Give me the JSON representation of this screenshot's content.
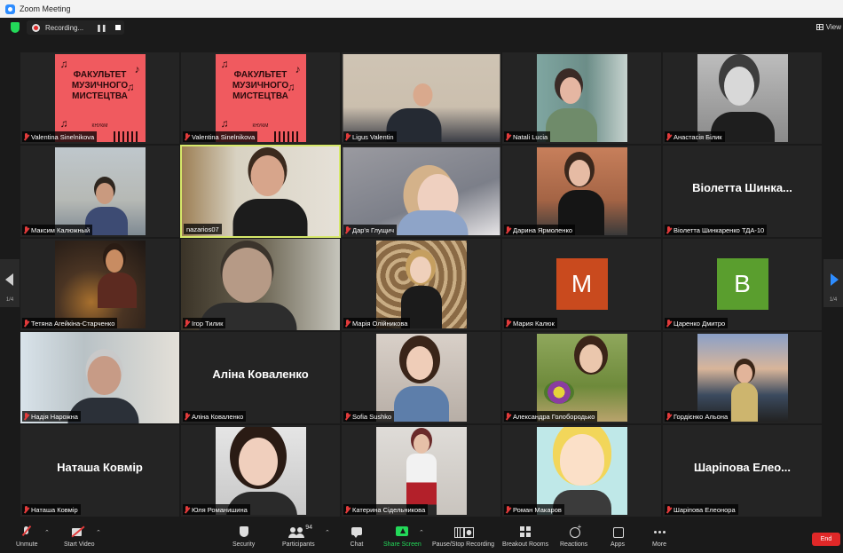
{
  "window": {
    "title": "Zoom Meeting"
  },
  "topbar": {
    "recording_label": "Recording...",
    "pause_glyph": "❚❚",
    "view_label": "View"
  },
  "poster": {
    "line1": "ФАКУЛЬТЕТ",
    "line2": "МУЗИЧНОГО",
    "line3": "МИСТЕЦТВА",
    "knu": "КНУКіМ"
  },
  "tiles": {
    "t1": {
      "name": "Valentina Sinelnikova"
    },
    "t2": {
      "name": "Valentina Sinelnikova"
    },
    "t3": {
      "name": "Ligus Valentin"
    },
    "t4": {
      "name": "Natali Lucia"
    },
    "t5": {
      "name": "Анастасія Білик"
    },
    "t6": {
      "name": "Максим Калюжный"
    },
    "t7": {
      "name": "nazarios07"
    },
    "t8": {
      "name": "Дар'я Глущич"
    },
    "t9": {
      "name": "Дарина Ярмоленко"
    },
    "t10": {
      "name": "Віолетта Шинкаренко ТДА-10",
      "display": "Віолетта Шинка..."
    },
    "t11": {
      "name": "Тетяна Агейкіна-Старченко"
    },
    "t12": {
      "name": "Ігор Тилик"
    },
    "t13": {
      "name": "Марія Олійникова"
    },
    "t14": {
      "name": "Мария Калюк",
      "initial": "M",
      "avatar_color": "#c94a1e"
    },
    "t15": {
      "name": "Царенко Дмитро",
      "initial": "B",
      "avatar_color": "#5a9e2e"
    },
    "t16": {
      "name": "Надія Нарожна"
    },
    "t17": {
      "name": "Аліна Коваленко",
      "display": "Аліна Коваленко"
    },
    "t18": {
      "name": "Sofia Sushko"
    },
    "t19": {
      "name": "Александра Голобородько"
    },
    "t20": {
      "name": "Гордієнко Альона"
    },
    "t21": {
      "name": "Наташа Ковмір",
      "display": "Наташа Ковмір"
    },
    "t22": {
      "name": "Юля Романишина"
    },
    "t23": {
      "name": "Катерина Сідельникова"
    },
    "t24": {
      "name": "Роман Макаров"
    },
    "t25": {
      "name": "Шаріпова Елеонора",
      "display": "Шаріпова Елео..."
    }
  },
  "nav": {
    "left_page": "1/4",
    "right_page": "1/4"
  },
  "toolbar": {
    "unmute": "Unmute",
    "start_video": "Start Video",
    "security": "Security",
    "participants": "Participants",
    "participants_count": "94",
    "chat": "Chat",
    "share_screen": "Share Screen",
    "pause_stop_recording": "Pause/Stop Recording",
    "breakout_rooms": "Breakout Rooms",
    "reactions": "Reactions",
    "apps": "Apps",
    "more": "More",
    "end": "End"
  },
  "colors": {
    "accent_blue": "#2d8cff",
    "share_green": "#23d959",
    "end_red": "#e02828",
    "active_speaker": "#d6e86a"
  }
}
